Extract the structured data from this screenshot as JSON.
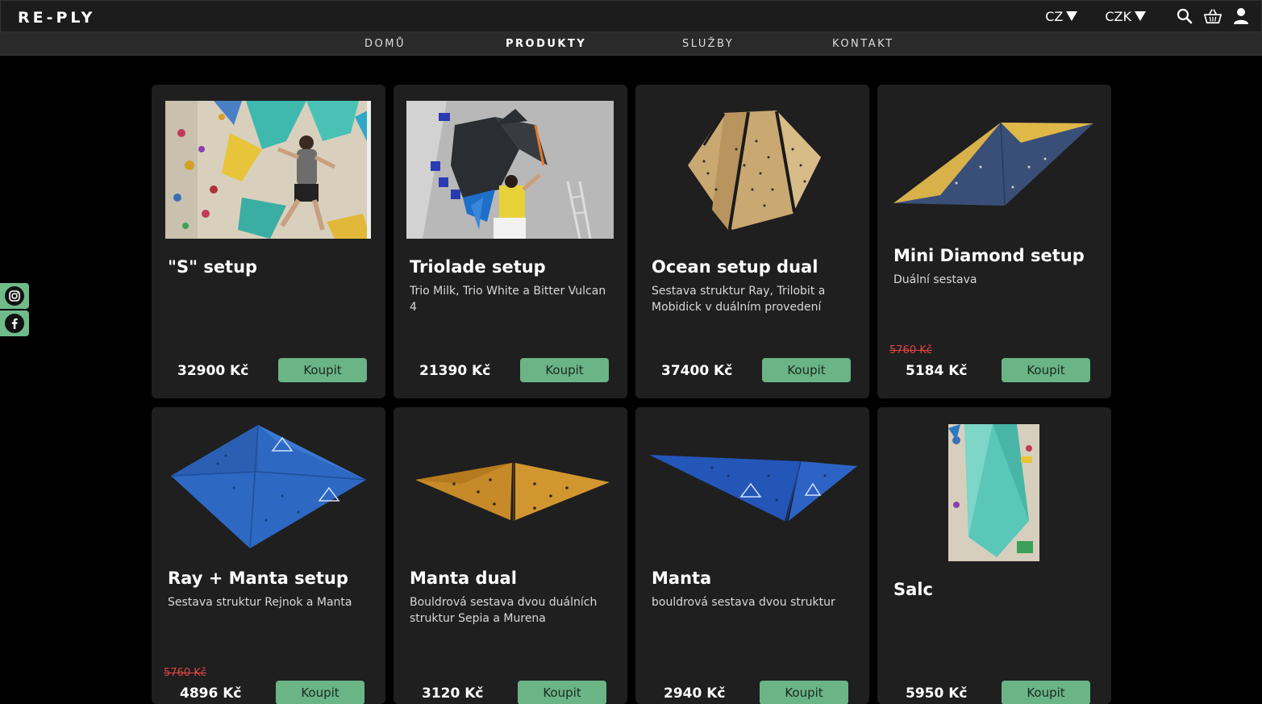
{
  "header": {
    "logo": "RE-PLY",
    "language": "CZ",
    "currency": "CZK"
  },
  "nav": [
    "DOMŮ",
    "PRODUKTY",
    "SLUŽBY",
    "KONTAKT"
  ],
  "nav_active": "PRODUKTY",
  "products": [
    {
      "title": "\"S\" setup",
      "desc": "",
      "old_price": "",
      "price": "32900 Kč",
      "buy": "Koupit"
    },
    {
      "title": "Triolade setup",
      "desc": "Trio Milk, Trio White a Bitter Vulcan 4",
      "old_price": "",
      "price": "21390 Kč",
      "buy": "Koupit"
    },
    {
      "title": "Ocean setup dual",
      "desc": "Sestava struktur Ray, Trilobit a Mobidick v duálním provedení",
      "old_price": "",
      "price": "37400 Kč",
      "buy": "Koupit"
    },
    {
      "title": "Mini Diamond setup",
      "desc": "Duální sestava",
      "old_price": "5760 Kč",
      "price": "5184 Kč",
      "buy": "Koupit"
    },
    {
      "title": "Ray + Manta setup",
      "desc": "Sestava struktur Rejnok a Manta",
      "old_price": "5760 Kč",
      "price": "4896 Kč",
      "buy": "Koupit"
    },
    {
      "title": "Manta dual",
      "desc": "Bouldrová sestava dvou duálních struktur Sepia a Murena",
      "old_price": "",
      "price": "3120 Kč",
      "buy": "Koupit"
    },
    {
      "title": "Manta",
      "desc": "bouldrová sestava dvou struktur",
      "old_price": "",
      "price": "2940 Kč",
      "buy": "Koupit"
    },
    {
      "title": "Salc",
      "desc": "",
      "old_price": "",
      "price": "5950 Kč",
      "buy": "Koupit"
    }
  ],
  "colors": {
    "accent": "#6ab486",
    "card_bg": "#1f1f1f",
    "old_price": "#e04242"
  },
  "icons": [
    "instagram-icon",
    "facebook-icon",
    "search-icon",
    "basket-icon",
    "user-icon"
  ]
}
